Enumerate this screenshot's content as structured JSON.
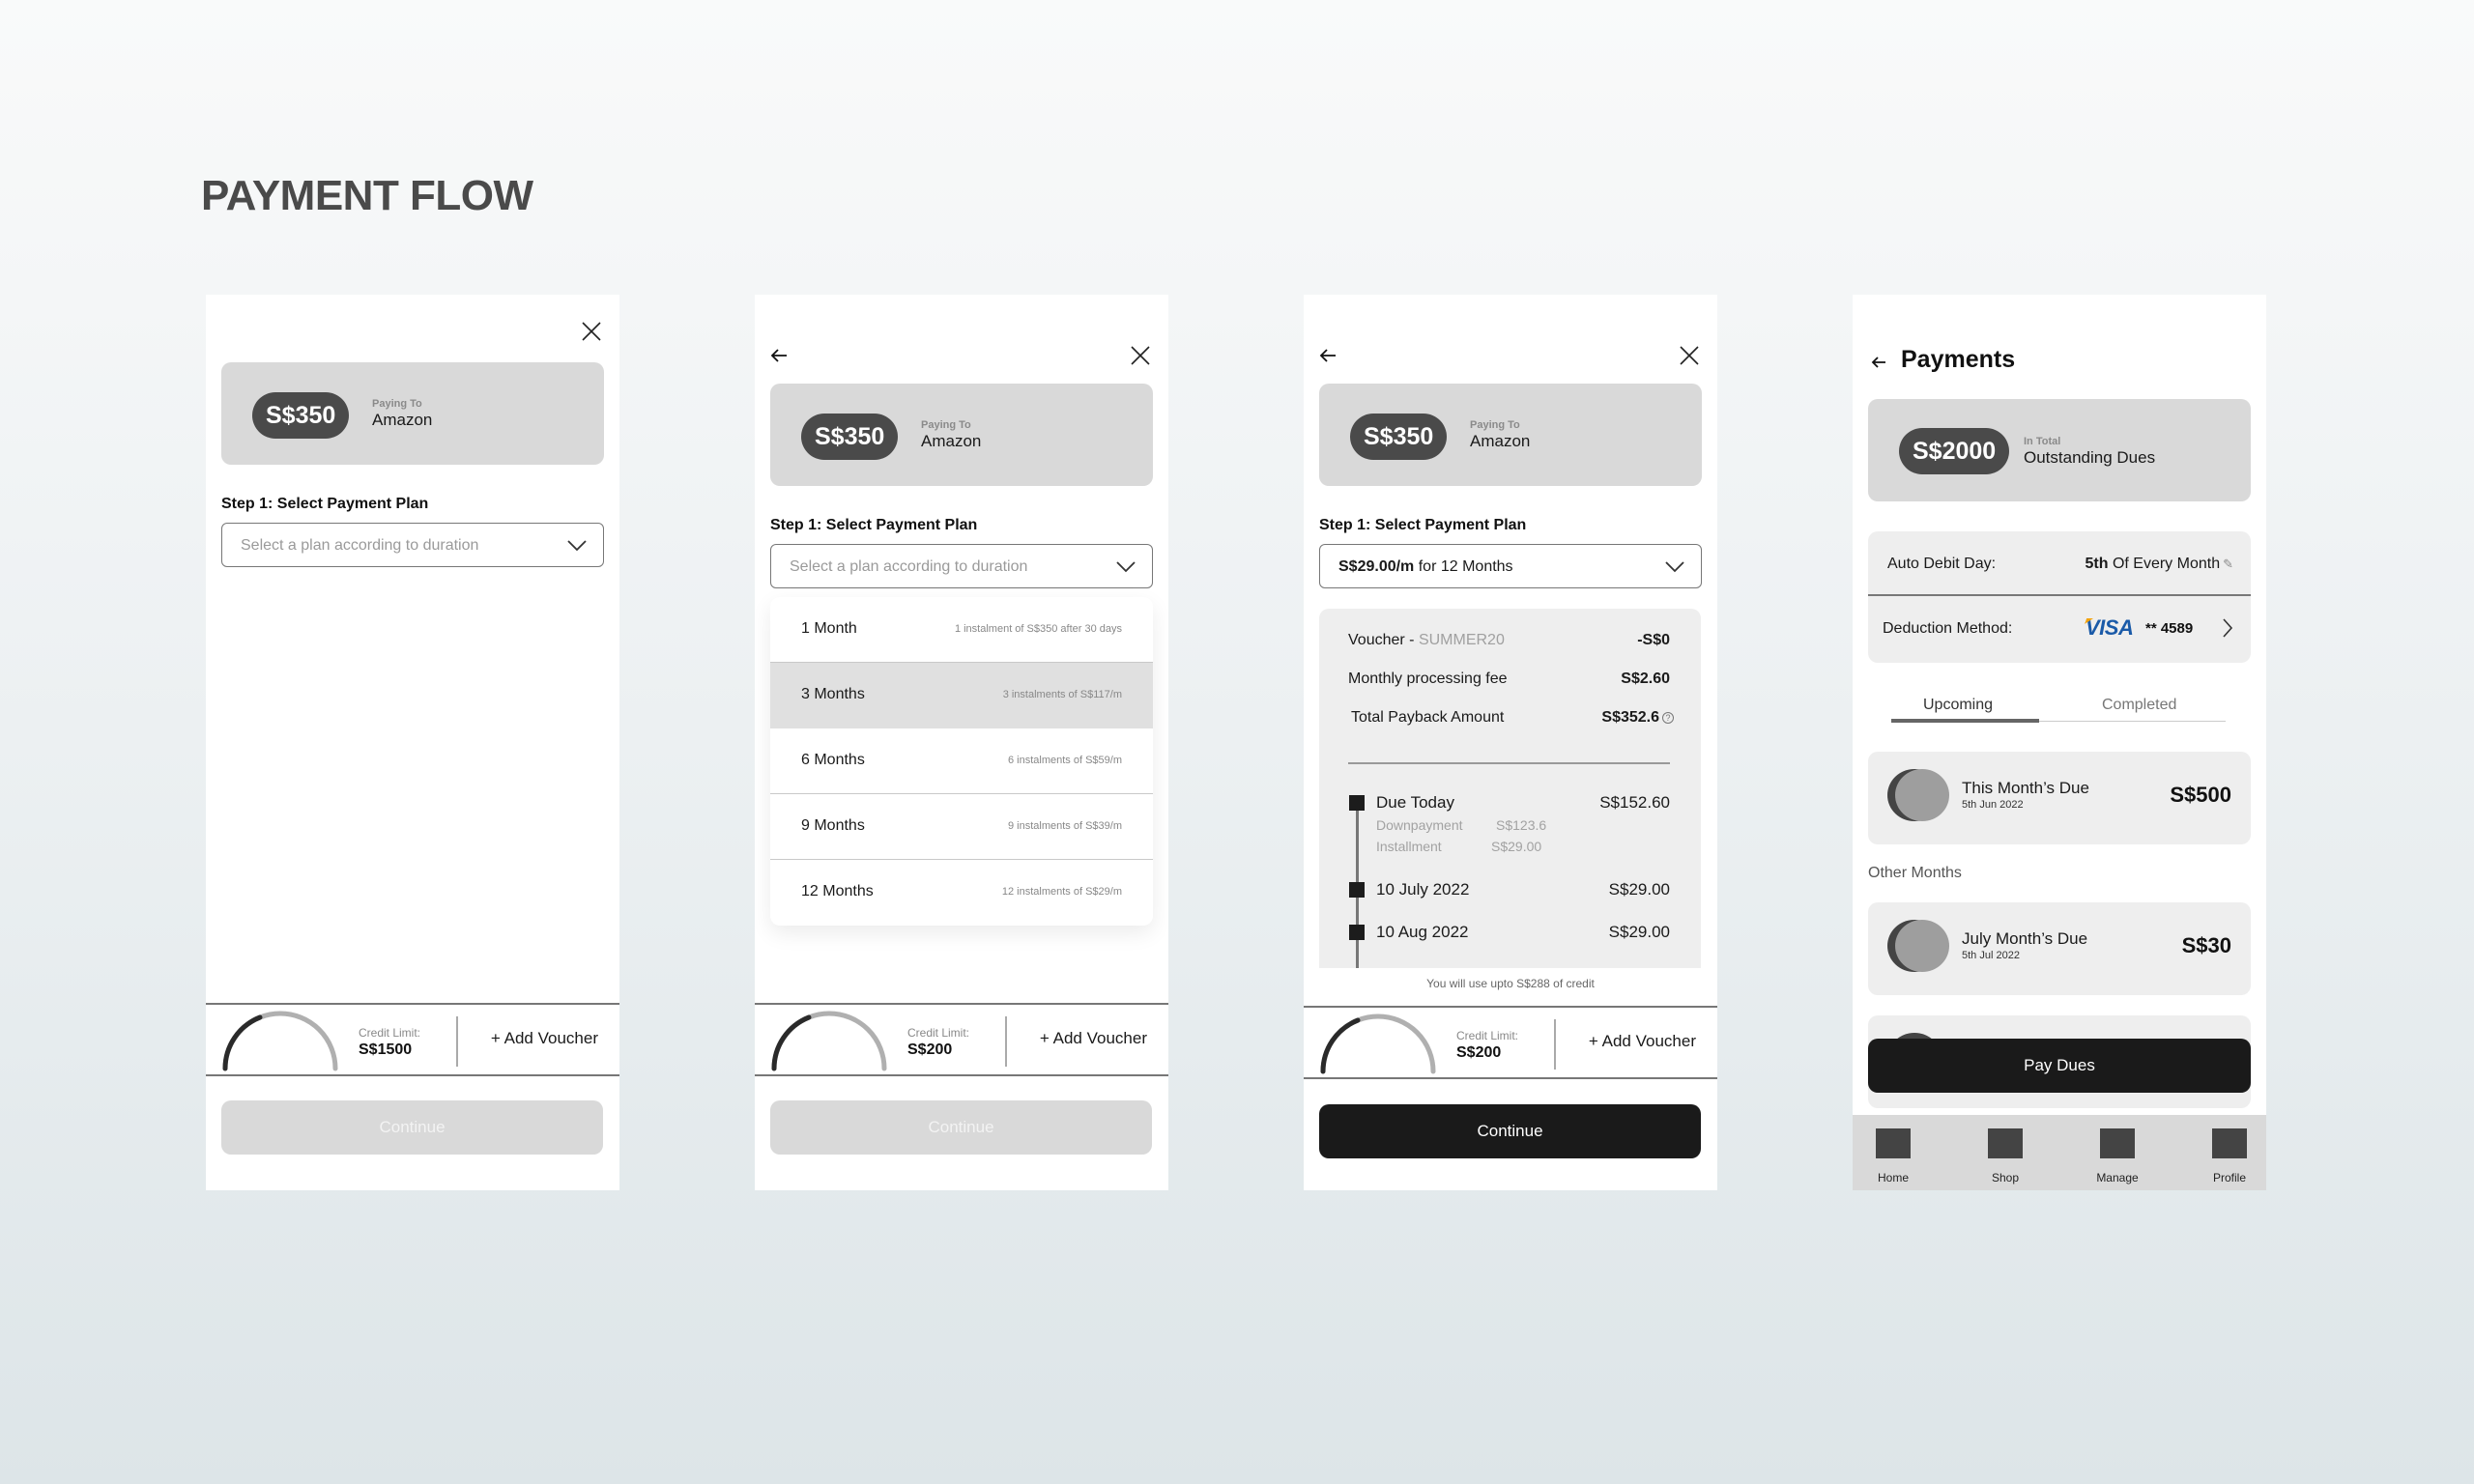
{
  "page": {
    "title": "PAYMENT FLOW"
  },
  "screens": {
    "s1": {
      "amount": "S$350",
      "paying_to_label": "Paying To",
      "merchant": "Amazon",
      "step_label": "Step 1: Select Payment Plan",
      "plan_placeholder": "Select a plan according to duration",
      "credit_limit_label": "Credit Limit:",
      "credit_limit": "S$1500",
      "credit_used_fraction": 0.38,
      "add_voucher": "+ Add Voucher",
      "continue": "Continue",
      "continue_enabled": false
    },
    "s2": {
      "amount": "S$350",
      "paying_to_label": "Paying To",
      "merchant": "Amazon",
      "step_label": "Step 1: Select Payment Plan",
      "plan_placeholder": "Select a plan according to duration",
      "plan_options": [
        {
          "label": "1 Month",
          "detail": "1 instalment of S$350 after 30 days",
          "highlighted": false
        },
        {
          "label": "3 Months",
          "detail": "3 instalments of S$117/m",
          "highlighted": true
        },
        {
          "label": "6 Months",
          "detail": "6 instalments of S$59/m",
          "highlighted": false
        },
        {
          "label": "9 Months",
          "detail": "9 instalments of S$39/m",
          "highlighted": false
        },
        {
          "label": "12 Months",
          "detail": "12 instalments of S$29/m",
          "highlighted": false
        }
      ],
      "credit_limit_label": "Credit Limit:",
      "credit_limit": "S$200",
      "credit_used_fraction": 0.38,
      "add_voucher": "+ Add Voucher",
      "continue": "Continue",
      "continue_enabled": false
    },
    "s3": {
      "amount": "S$350",
      "paying_to_label": "Paying To",
      "merchant": "Amazon",
      "step_label": "Step 1: Select Payment Plan",
      "selected_plan_amount": "S$29.00/m",
      "selected_plan_suffix": " for 12 Months",
      "summary": {
        "voucher_label": "Voucher - ",
        "voucher_code": "SUMMER20",
        "voucher_value": "-S$0",
        "fee_label": "Monthly processing fee",
        "fee_value": "S$2.60",
        "total_label": "Total Payback Amount",
        "total_value": "S$352.6",
        "help_glyph": "?"
      },
      "schedule": [
        {
          "label": "Due Today",
          "amount": "S$152.60",
          "breakdown": [
            {
              "label": "Downpayment",
              "value": "S$123.6"
            },
            {
              "label": "Installment",
              "value": "S$29.00"
            }
          ]
        },
        {
          "label": "10 July 2022",
          "amount": "S$29.00"
        },
        {
          "label": "10 Aug 2022",
          "amount": "S$29.00"
        }
      ],
      "credit_note": "You will use upto S$288 of credit",
      "credit_limit_label": "Credit Limit:",
      "credit_limit": "S$200",
      "credit_used_fraction": 0.38,
      "add_voucher": "+ Add Voucher",
      "continue": "Continue",
      "continue_enabled": true
    },
    "s4": {
      "title": "Payments",
      "amount": "S$2000",
      "amount_small": "In Total",
      "amount_big": "Outstanding Dues",
      "auto_debit_label": "Auto Debit Day:",
      "auto_debit_day": "5th",
      "auto_debit_suffix": " Of Every Month",
      "deduction_label": "Deduction Method:",
      "card_brand": "VISA",
      "card_number": "** 4589",
      "tabs": [
        {
          "label": "Upcoming",
          "active": true
        },
        {
          "label": "Completed",
          "active": false
        }
      ],
      "this_month": {
        "name": "This Month’s Due",
        "date": "5th Jun 2022",
        "amount": "S$500"
      },
      "other_months_label": "Other Months",
      "other_months": [
        {
          "name": "July Month’s Due",
          "date": "5th Jul 2022",
          "amount": "S$30"
        }
      ],
      "pay_dues": "Pay Dues",
      "nav": [
        {
          "label": "Home"
        },
        {
          "label": "Shop"
        },
        {
          "label": "Manage"
        },
        {
          "label": "Profile"
        }
      ]
    }
  },
  "colors": {
    "primary_button": "#1a1a1a",
    "disabled_button": "#d9d9d9",
    "card_gray": "#d9d9d9",
    "pill_dark": "#4a4a4a",
    "visa_blue": "#1a5aa8",
    "visa_gold": "#f2a30f"
  }
}
